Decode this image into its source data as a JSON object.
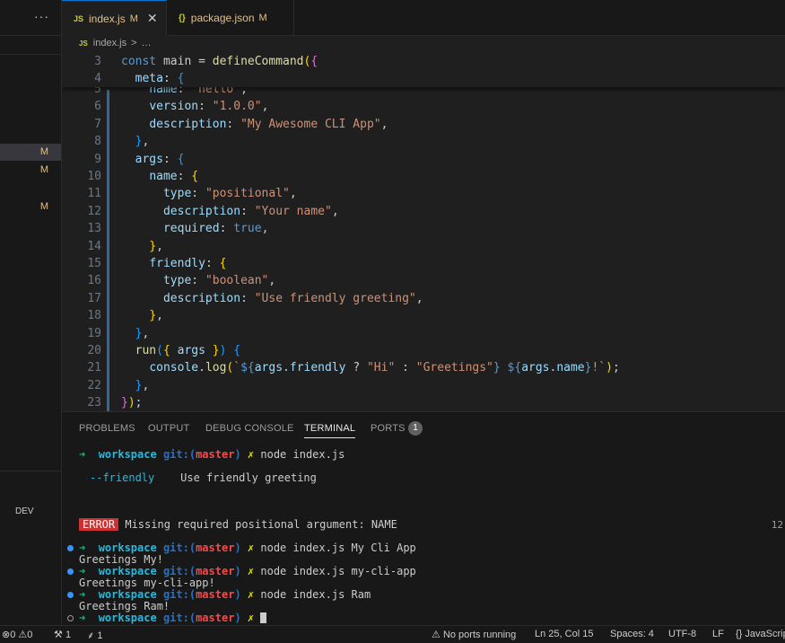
{
  "sidebar": {
    "menu_glyph": "···",
    "modified_markers": [
      "M",
      "M",
      "M"
    ],
    "dev_label": "DEV"
  },
  "tabs": [
    {
      "icon": "JS",
      "label": "index.js",
      "modified": "M",
      "close": "✕",
      "active": true
    },
    {
      "icon": "{}",
      "label": "package.json",
      "modified": "M",
      "active": false
    }
  ],
  "breadcrumb": {
    "icon": "JS",
    "file": "index.js",
    "sep": ">",
    "rest": "…"
  },
  "editor": {
    "lines": [
      {
        "n": "3",
        "tokens": [
          [
            "k",
            "const "
          ],
          [
            "",
            "main = "
          ],
          [
            "f",
            "defineCommand"
          ],
          [
            "b",
            "("
          ],
          [
            "b2",
            "{"
          ]
        ]
      },
      {
        "n": "4",
        "tokens": [
          [
            "",
            "  "
          ],
          [
            "p",
            "meta"
          ],
          [
            "",
            ": "
          ],
          [
            "b3",
            "{"
          ]
        ]
      },
      {
        "n": "5",
        "tokens": [
          [
            "",
            "    "
          ],
          [
            "p",
            "name"
          ],
          [
            "",
            ": "
          ],
          [
            "s",
            "\"hello\""
          ],
          [
            "",
            ","
          ]
        ]
      },
      {
        "n": "6",
        "tokens": [
          [
            "",
            "    "
          ],
          [
            "p",
            "version"
          ],
          [
            "",
            ": "
          ],
          [
            "s",
            "\"1.0.0\""
          ],
          [
            "",
            ","
          ]
        ]
      },
      {
        "n": "7",
        "tokens": [
          [
            "",
            "    "
          ],
          [
            "p",
            "description"
          ],
          [
            "",
            ": "
          ],
          [
            "s",
            "\"My Awesome CLI App\""
          ],
          [
            "",
            ","
          ]
        ]
      },
      {
        "n": "8",
        "tokens": [
          [
            "",
            "  "
          ],
          [
            "b3",
            "}"
          ],
          [
            "",
            ","
          ]
        ]
      },
      {
        "n": "9",
        "tokens": [
          [
            "",
            "  "
          ],
          [
            "p",
            "args"
          ],
          [
            "",
            ": "
          ],
          [
            "b3",
            "{"
          ]
        ]
      },
      {
        "n": "10",
        "tokens": [
          [
            "",
            "    "
          ],
          [
            "p",
            "name"
          ],
          [
            "",
            ": "
          ],
          [
            "b",
            "{"
          ]
        ]
      },
      {
        "n": "11",
        "tokens": [
          [
            "",
            "      "
          ],
          [
            "p",
            "type"
          ],
          [
            "",
            ": "
          ],
          [
            "s",
            "\"positional\""
          ],
          [
            "",
            ","
          ]
        ]
      },
      {
        "n": "12",
        "tokens": [
          [
            "",
            "      "
          ],
          [
            "p",
            "description"
          ],
          [
            "",
            ": "
          ],
          [
            "s",
            "\"Your name\""
          ],
          [
            "",
            ","
          ]
        ]
      },
      {
        "n": "13",
        "tokens": [
          [
            "",
            "      "
          ],
          [
            "p",
            "required"
          ],
          [
            "",
            ": "
          ],
          [
            "t",
            "true"
          ],
          [
            "",
            ","
          ]
        ]
      },
      {
        "n": "14",
        "tokens": [
          [
            "",
            "    "
          ],
          [
            "b",
            "}"
          ],
          [
            "",
            ","
          ]
        ]
      },
      {
        "n": "15",
        "tokens": [
          [
            "",
            "    "
          ],
          [
            "p",
            "friendly"
          ],
          [
            "",
            ": "
          ],
          [
            "b",
            "{"
          ]
        ]
      },
      {
        "n": "16",
        "tokens": [
          [
            "",
            "      "
          ],
          [
            "p",
            "type"
          ],
          [
            "",
            ": "
          ],
          [
            "s",
            "\"boolean\""
          ],
          [
            "",
            ","
          ]
        ]
      },
      {
        "n": "17",
        "tokens": [
          [
            "",
            "      "
          ],
          [
            "p",
            "description"
          ],
          [
            "",
            ": "
          ],
          [
            "s",
            "\"Use friendly greeting\""
          ],
          [
            "",
            ","
          ]
        ]
      },
      {
        "n": "18",
        "tokens": [
          [
            "",
            "    "
          ],
          [
            "b",
            "}"
          ],
          [
            "",
            ","
          ]
        ]
      },
      {
        "n": "19",
        "tokens": [
          [
            "",
            "  "
          ],
          [
            "b3",
            "}"
          ],
          [
            "",
            ","
          ]
        ]
      },
      {
        "n": "20",
        "tokens": [
          [
            "",
            "  "
          ],
          [
            "f",
            "run"
          ],
          [
            "b3",
            "("
          ],
          [
            "b",
            "{ "
          ],
          [
            "p",
            "args"
          ],
          [
            "b",
            " }"
          ],
          [
            "b3",
            ")"
          ],
          [
            "",
            " "
          ],
          [
            "b3",
            "{"
          ]
        ]
      },
      {
        "n": "21",
        "tokens": [
          [
            "",
            "    "
          ],
          [
            "p",
            "console"
          ],
          [
            "",
            "."
          ],
          [
            "f",
            "log"
          ],
          [
            "b",
            "("
          ],
          [
            "s",
            "`"
          ],
          [
            "k",
            "${"
          ],
          [
            "p",
            "args"
          ],
          [
            "",
            "."
          ],
          [
            "p",
            "friendly"
          ],
          [
            "",
            " ? "
          ],
          [
            "s",
            "\"Hi\""
          ],
          [
            "",
            " : "
          ],
          [
            "s",
            "\"Greetings\""
          ],
          [
            "k",
            "}"
          ],
          [
            "s",
            " "
          ],
          [
            "k",
            "${"
          ],
          [
            "p",
            "args"
          ],
          [
            "",
            "."
          ],
          [
            "p",
            "name"
          ],
          [
            "k",
            "}"
          ],
          [
            "s",
            "!`"
          ],
          [
            "b",
            ")"
          ],
          [
            "",
            ";"
          ]
        ]
      },
      {
        "n": "22",
        "tokens": [
          [
            "",
            "  "
          ],
          [
            "b3",
            "}"
          ],
          [
            "",
            ","
          ]
        ]
      },
      {
        "n": "23",
        "tokens": [
          [
            "b2",
            "}"
          ],
          [
            "b",
            ")"
          ],
          [
            "",
            ";"
          ]
        ]
      }
    ]
  },
  "panel": {
    "tabs": [
      {
        "label": "PROBLEMS"
      },
      {
        "label": "OUTPUT"
      },
      {
        "label": "DEBUG CONSOLE"
      },
      {
        "label": "TERMINAL"
      },
      {
        "label": "PORTS"
      }
    ],
    "ports_badge": "1",
    "terminal": {
      "arrow": "➜",
      "dir": "workspace",
      "git": "git:(",
      "branch": "master",
      "git_close": ")",
      "x": "✗",
      "cmd1": "node index.js",
      "flag": "--friendly",
      "flag_desc": "Use friendly greeting",
      "error_badge": "ERROR",
      "error_msg": "Missing required positional argument: NAME",
      "right_num": "12",
      "cmd2": "node index.js My Cli App",
      "out2": "Greetings My!",
      "cmd3": "node index.js my-cli-app",
      "out3": "Greetings my-cli-app!",
      "cmd4": "node index.js Ram",
      "out4": "Greetings Ram!"
    }
  },
  "status": {
    "errors": "0",
    "warnings": "0",
    "tools": "1",
    "remote": "1",
    "ports": "No ports running",
    "position": "Ln 25, Col 15",
    "spaces": "Spaces: 4",
    "encoding": "UTF-8",
    "eol": "LF",
    "language": "JavaScript"
  }
}
